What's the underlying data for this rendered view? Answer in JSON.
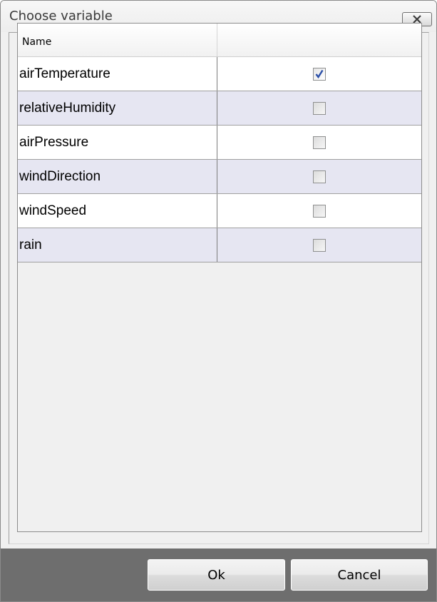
{
  "window": {
    "title": "Choose variable",
    "close_icon": "close-icon"
  },
  "table": {
    "columns": [
      "Name",
      ""
    ],
    "rows": [
      {
        "name": "airTemperature",
        "checked": true
      },
      {
        "name": "relativeHumidity",
        "checked": false
      },
      {
        "name": "airPressure",
        "checked": false
      },
      {
        "name": "windDirection",
        "checked": false
      },
      {
        "name": "windSpeed",
        "checked": false
      },
      {
        "name": "rain",
        "checked": false
      }
    ]
  },
  "buttons": {
    "ok_label": "Ok",
    "cancel_label": "Cancel"
  },
  "colors": {
    "row_alt": "#e6e6f2",
    "footer": "#6e6e6e",
    "check_mark": "#2b4fa8"
  }
}
